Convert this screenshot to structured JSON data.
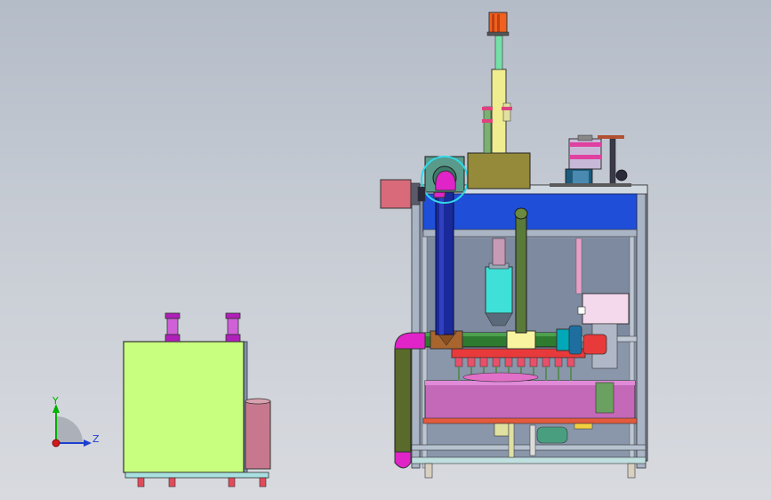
{
  "triad": {
    "y_label": "Y",
    "z_label": "Z"
  },
  "colors": {
    "background_top": "#b4bcc8",
    "background_bottom": "#d8dadf",
    "triad_y": "#00b000",
    "triad_z": "#1d3fd1",
    "triad_x": "#d21a1a"
  }
}
